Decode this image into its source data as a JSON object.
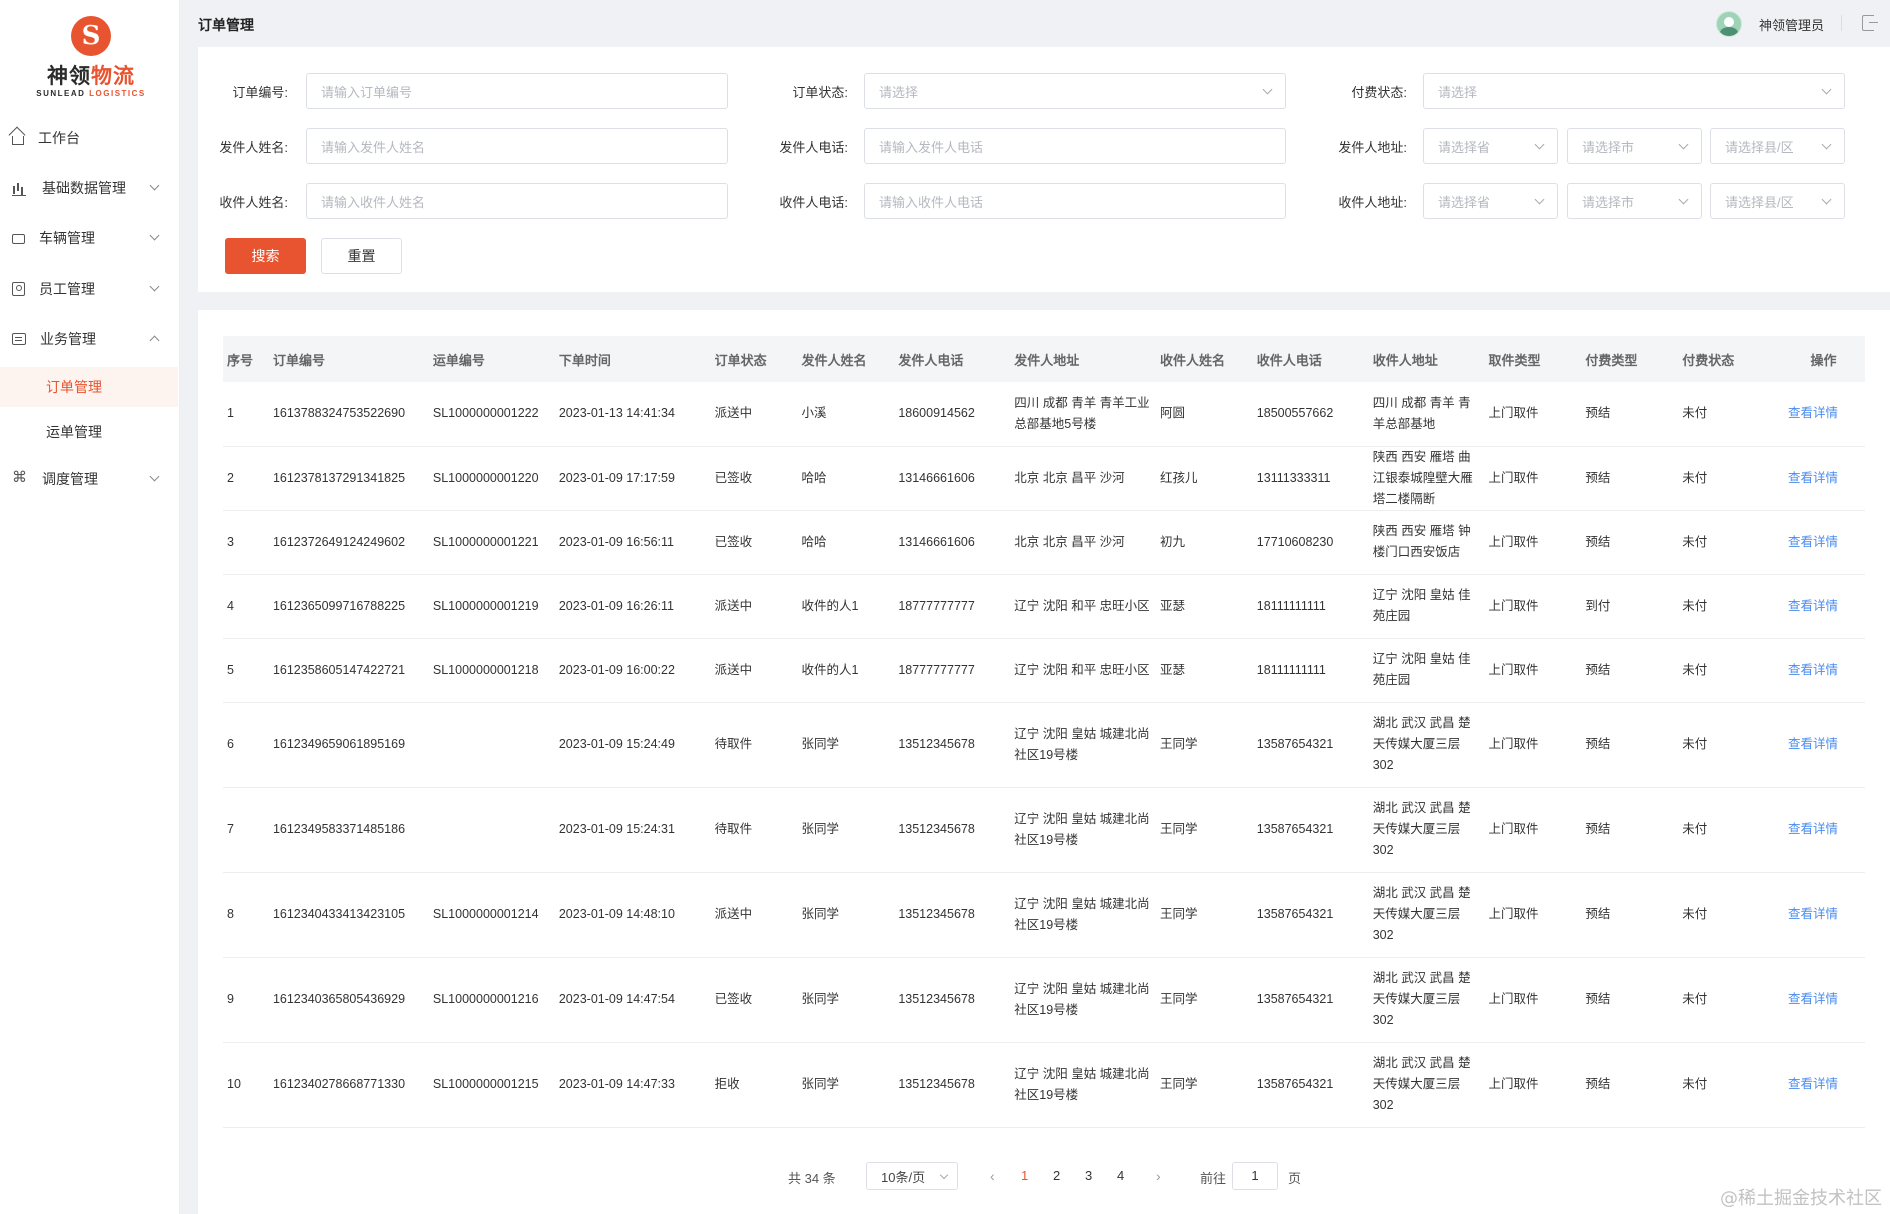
{
  "logo": {
    "mark": "S",
    "cn_a": "神领",
    "cn_b": "物流",
    "en_a": "SUNLEAD",
    "en_b": "LOGISTICS"
  },
  "nav": [
    {
      "label": "工作台",
      "icon": "home-icon"
    },
    {
      "label": "基础数据管理",
      "icon": "bar-chart-icon"
    },
    {
      "label": "车辆管理",
      "icon": "truck-icon"
    },
    {
      "label": "员工管理",
      "icon": "employee-icon"
    },
    {
      "label": "业务管理",
      "icon": "business-icon"
    },
    {
      "label": "调度管理",
      "icon": "schedule-icon"
    }
  ],
  "subnav": [
    "订单管理",
    "运单管理"
  ],
  "header": {
    "title": "订单管理",
    "user": "神领管理员"
  },
  "filters": {
    "order_no": {
      "label": "订单编号:",
      "placeholder": "请输入订单编号"
    },
    "order_status": {
      "label": "订单状态:",
      "placeholder": "请选择"
    },
    "pay_status": {
      "label": "付费状态:",
      "placeholder": "请选择"
    },
    "sender_name": {
      "label": "发件人姓名:",
      "placeholder": "请输入发件人姓名"
    },
    "sender_phone": {
      "label": "发件人电话:",
      "placeholder": "请输入发件人电话"
    },
    "sender_addr": {
      "label": "发件人地址:",
      "province": "请选择省",
      "city": "请选择市",
      "county": "请选择县/区"
    },
    "receiver_name": {
      "label": "收件人姓名:",
      "placeholder": "请输入收件人姓名"
    },
    "receiver_phone": {
      "label": "收件人电话:",
      "placeholder": "请输入收件人电话"
    },
    "receiver_addr": {
      "label": "收件人地址:",
      "province": "请选择省",
      "city": "请选择市",
      "county": "请选择县/区"
    },
    "search_btn": "搜索",
    "reset_btn": "重置"
  },
  "table": {
    "columns": [
      "序号",
      "订单编号",
      "运单编号",
      "下单时间",
      "订单状态",
      "发件人姓名",
      "发件人电话",
      "发件人地址",
      "收件人姓名",
      "收件人电话",
      "收件人地址",
      "取件类型",
      "付费类型",
      "付费状态",
      "操作"
    ],
    "rows": [
      [
        "1",
        "1613788324753522690",
        "SL1000000001222",
        "2023-01-13 14:41:34",
        "派送中",
        "小溪",
        "18600914562",
        "四川 成都 青羊 青羊工业总部基地5号楼",
        "阿圆",
        "18500557662",
        "四川 成都 青羊 青羊总部基地",
        "上门取件",
        "预结",
        "未付",
        "查看详情"
      ],
      [
        "2",
        "1612378137291341825",
        "SL1000000001220",
        "2023-01-09 17:17:59",
        "已签收",
        "哈哈",
        "13146661606",
        "北京 北京 昌平 沙河",
        "红孩儿",
        "13111333311",
        "陕西 西安 雁塔 曲江银泰城隍壁大雁塔二楼隔断",
        "上门取件",
        "预结",
        "未付",
        "查看详情"
      ],
      [
        "3",
        "1612372649124249602",
        "SL1000000001221",
        "2023-01-09 16:56:11",
        "已签收",
        "哈哈",
        "13146661606",
        "北京 北京 昌平 沙河",
        "初九",
        "17710608230",
        "陕西 西安 雁塔 钟楼门口西安饭店",
        "上门取件",
        "预结",
        "未付",
        "查看详情"
      ],
      [
        "4",
        "1612365099716788225",
        "SL1000000001219",
        "2023-01-09 16:26:11",
        "派送中",
        "收件的人1",
        "18777777777",
        "辽宁 沈阳 和平 忠旺小区",
        "亚瑟",
        "18111111111",
        "辽宁 沈阳 皇姑 佳苑庄园",
        "上门取件",
        "到付",
        "未付",
        "查看详情"
      ],
      [
        "5",
        "1612358605147422721",
        "SL1000000001218",
        "2023-01-09 16:00:22",
        "派送中",
        "收件的人1",
        "18777777777",
        "辽宁 沈阳 和平 忠旺小区",
        "亚瑟",
        "18111111111",
        "辽宁 沈阳 皇姑 佳苑庄园",
        "上门取件",
        "预结",
        "未付",
        "查看详情"
      ],
      [
        "6",
        "1612349659061895169",
        "",
        "2023-01-09 15:24:49",
        "待取件",
        "张同学",
        "13512345678",
        "辽宁 沈阳 皇姑 城建北尚社区19号楼",
        "王同学",
        "13587654321",
        "湖北 武汉 武昌 楚天传媒大厦三层302",
        "上门取件",
        "预结",
        "未付",
        "查看详情"
      ],
      [
        "7",
        "1612349583371485186",
        "",
        "2023-01-09 15:24:31",
        "待取件",
        "张同学",
        "13512345678",
        "辽宁 沈阳 皇姑 城建北尚社区19号楼",
        "王同学",
        "13587654321",
        "湖北 武汉 武昌 楚天传媒大厦三层302",
        "上门取件",
        "预结",
        "未付",
        "查看详情"
      ],
      [
        "8",
        "1612340433413423105",
        "SL1000000001214",
        "2023-01-09 14:48:10",
        "派送中",
        "张同学",
        "13512345678",
        "辽宁 沈阳 皇姑 城建北尚社区19号楼",
        "王同学",
        "13587654321",
        "湖北 武汉 武昌 楚天传媒大厦三层302",
        "上门取件",
        "预结",
        "未付",
        "查看详情"
      ],
      [
        "9",
        "1612340365805436929",
        "SL1000000001216",
        "2023-01-09 14:47:54",
        "已签收",
        "张同学",
        "13512345678",
        "辽宁 沈阳 皇姑 城建北尚社区19号楼",
        "王同学",
        "13587654321",
        "湖北 武汉 武昌 楚天传媒大厦三层302",
        "上门取件",
        "预结",
        "未付",
        "查看详情"
      ],
      [
        "10",
        "1612340278668771330",
        "SL1000000001215",
        "2023-01-09 14:47:33",
        "拒收",
        "张同学",
        "13512345678",
        "辽宁 沈阳 皇姑 城建北尚社区19号楼",
        "王同学",
        "13587654321",
        "湖北 武汉 武昌 楚天传媒大厦三层302",
        "上门取件",
        "预结",
        "未付",
        "查看详情"
      ]
    ]
  },
  "pagination": {
    "total": "共 34 条",
    "page_size": "10条/页",
    "pages": [
      "1",
      "2",
      "3",
      "4"
    ],
    "current": "1",
    "goto_label": "前往",
    "goto_value": "1",
    "page_label": "页",
    "prev": "‹",
    "next": "›"
  },
  "watermark": "@稀土掘金技术社区",
  "colors": {
    "accent": "#e8542f",
    "link": "#4a8cf0",
    "background": "#f0f1f5"
  }
}
